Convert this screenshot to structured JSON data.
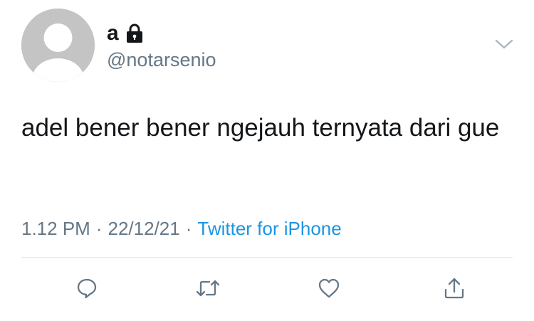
{
  "user": {
    "display_name": "a",
    "handle": "@notarsenio",
    "protected_icon": "lock-icon",
    "avatar_icon": "default-avatar-icon"
  },
  "tweet": {
    "text": "adel bener bener ngejauh ternyata dari gue",
    "time": "1.12 PM",
    "date": "22/12/21",
    "separator": "·",
    "source": "Twitter for iPhone"
  },
  "menu_icon": "chevron-down-icon",
  "actions": [
    {
      "name": "reply",
      "icon": "reply-icon"
    },
    {
      "name": "retweet",
      "icon": "retweet-icon"
    },
    {
      "name": "like",
      "icon": "heart-icon"
    },
    {
      "name": "share",
      "icon": "share-icon"
    }
  ],
  "colors": {
    "text": "#14171a",
    "secondary": "#657786",
    "link": "#1b95e0",
    "avatar_bg": "#c4c4c4",
    "divider": "#e1e8ed"
  }
}
